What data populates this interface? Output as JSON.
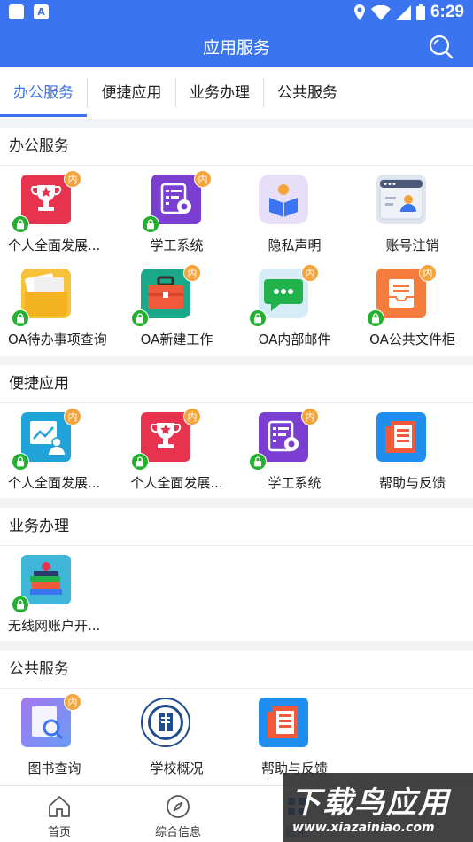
{
  "status_bar": {
    "time": "6:29",
    "keyboard_glyph": "A"
  },
  "app_bar": {
    "title": "应用服务"
  },
  "tabs": [
    {
      "label": "办公服务",
      "active": true
    },
    {
      "label": "便捷应用",
      "active": false
    },
    {
      "label": "业务办理",
      "active": false
    },
    {
      "label": "公共服务",
      "active": false
    }
  ],
  "badge_text": "内",
  "sections": {
    "office": {
      "title": "办公服务",
      "items": [
        {
          "label": "个人全面发展...",
          "icon": "trophy-icon"
        },
        {
          "label": "学工系统",
          "icon": "system-settings-icon"
        },
        {
          "label": "隐私声明",
          "icon": "reading-person-icon"
        },
        {
          "label": "账号注销",
          "icon": "account-window-icon"
        },
        {
          "label": "OA待办事项查询",
          "icon": "folder-documents-icon"
        },
        {
          "label": "OA新建工作",
          "icon": "briefcase-icon"
        },
        {
          "label": "OA内部邮件",
          "icon": "chat-bubble-icon"
        },
        {
          "label": "OA公共文件柜",
          "icon": "inbox-tray-icon"
        }
      ]
    },
    "convenient": {
      "title": "便捷应用",
      "items": [
        {
          "label": "个人全面发展...",
          "icon": "chart-person-icon"
        },
        {
          "label": "个人全面发展...",
          "icon": "trophy-icon"
        },
        {
          "label": "学工系统",
          "icon": "system-settings-icon"
        },
        {
          "label": "帮助与反馈",
          "icon": "newspaper-icon"
        }
      ]
    },
    "business": {
      "title": "业务办理",
      "items": [
        {
          "label": "无线网账户开...",
          "icon": "books-apple-icon"
        }
      ]
    },
    "public": {
      "title": "公共服务",
      "items": [
        {
          "label": "图书查询",
          "icon": "book-search-icon"
        },
        {
          "label": "学校概况",
          "icon": "university-seal-icon"
        },
        {
          "label": "帮助与反馈",
          "icon": "newspaper-icon"
        }
      ]
    }
  },
  "bottom_nav": [
    {
      "label": "首页",
      "icon": "home-icon",
      "active": false
    },
    {
      "label": "综合信息",
      "icon": "compass-icon",
      "active": false
    },
    {
      "label": "应用",
      "icon": "apps-icon",
      "active": true
    }
  ],
  "watermark": {
    "main": "下载鸟应用",
    "url": "www.xiazainiao.com"
  },
  "colors": {
    "brand": "#3b74f0",
    "badge_orange": "#f5a33b",
    "lock_green": "#22b02e"
  }
}
